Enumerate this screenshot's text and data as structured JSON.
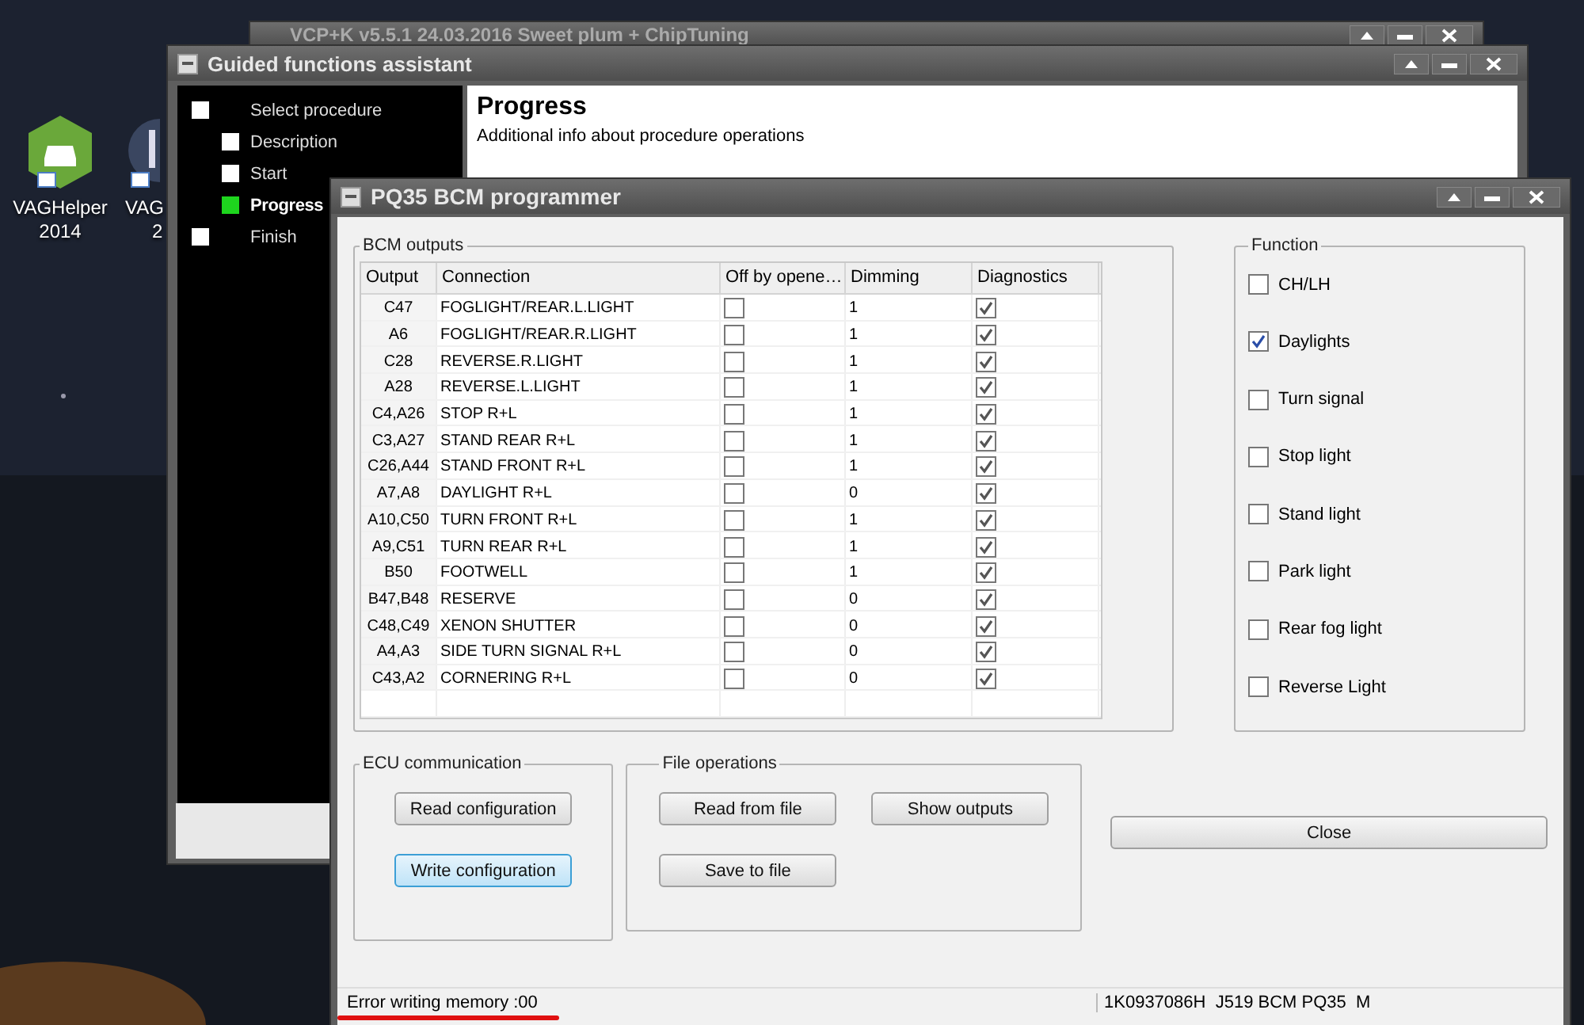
{
  "desktop": {
    "icons": [
      {
        "kind": "car",
        "lines": [
          "VAGHelper",
          "2014"
        ]
      },
      {
        "kind": "round",
        "lines": [
          "VAG",
          "2"
        ]
      }
    ]
  },
  "back_window": {
    "title": "VCP+K v5.5.1 24.03.2016 Sweet plum + ChipTuning"
  },
  "guided_window": {
    "title": "Guided functions assistant",
    "steps": [
      {
        "label": "Select procedure",
        "selected": false
      },
      {
        "label": "Description",
        "selected": false
      },
      {
        "label": "Start",
        "selected": false
      },
      {
        "label": "Progress",
        "selected": true
      },
      {
        "label": "Finish",
        "selected": false
      }
    ],
    "header": {
      "title": "Progress",
      "subtitle": "Additional info about procedure operations"
    }
  },
  "programmer": {
    "title": "PQ35 BCM programmer",
    "bcm_outputs": {
      "legend": "BCM outputs",
      "columns": [
        "Output",
        "Connection",
        "Off by opene…",
        "Dimming",
        "Diagnostics"
      ],
      "rows": [
        {
          "output": "C47",
          "connection": "FOGLIGHT/REAR.L.LIGHT",
          "off_by_opener": false,
          "dimming": "1",
          "diagnostics": true
        },
        {
          "output": "A6",
          "connection": "FOGLIGHT/REAR.R.LIGHT",
          "off_by_opener": false,
          "dimming": "1",
          "diagnostics": true
        },
        {
          "output": "C28",
          "connection": "REVERSE.R.LIGHT",
          "off_by_opener": false,
          "dimming": "1",
          "diagnostics": true
        },
        {
          "output": "A28",
          "connection": "REVERSE.L.LIGHT",
          "off_by_opener": false,
          "dimming": "1",
          "diagnostics": true
        },
        {
          "output": "C4,A26",
          "connection": "STOP R+L",
          "off_by_opener": false,
          "dimming": "1",
          "diagnostics": true
        },
        {
          "output": "C3,A27",
          "connection": "STAND REAR R+L",
          "off_by_opener": false,
          "dimming": "1",
          "diagnostics": true
        },
        {
          "output": "C26,A44",
          "connection": "STAND FRONT R+L",
          "off_by_opener": false,
          "dimming": "1",
          "diagnostics": true
        },
        {
          "output": "A7,A8",
          "connection": "DAYLIGHT R+L",
          "off_by_opener": false,
          "dimming": "0",
          "diagnostics": true
        },
        {
          "output": "A10,C50",
          "connection": "TURN FRONT R+L",
          "off_by_opener": false,
          "dimming": "1",
          "diagnostics": true
        },
        {
          "output": "A9,C51",
          "connection": "TURN REAR R+L",
          "off_by_opener": false,
          "dimming": "1",
          "diagnostics": true
        },
        {
          "output": "B50",
          "connection": "FOOTWELL",
          "off_by_opener": false,
          "dimming": "1",
          "diagnostics": true
        },
        {
          "output": "B47,B48",
          "connection": "RESERVE",
          "off_by_opener": false,
          "dimming": "0",
          "diagnostics": true
        },
        {
          "output": "C48,C49",
          "connection": "XENON SHUTTER",
          "off_by_opener": false,
          "dimming": "0",
          "diagnostics": true
        },
        {
          "output": "A4,A3",
          "connection": "SIDE TURN SIGNAL R+L",
          "off_by_opener": false,
          "dimming": "0",
          "diagnostics": true
        },
        {
          "output": "C43,A2",
          "connection": "CORNERING R+L",
          "off_by_opener": false,
          "dimming": "0",
          "diagnostics": true
        }
      ]
    },
    "function": {
      "legend": "Function",
      "options": [
        {
          "label": "CH/LH",
          "checked": false
        },
        {
          "label": "Daylights",
          "checked": true
        },
        {
          "label": "Turn signal",
          "checked": false
        },
        {
          "label": "Stop light",
          "checked": false
        },
        {
          "label": "Stand light",
          "checked": false
        },
        {
          "label": "Park light",
          "checked": false
        },
        {
          "label": "Rear fog light",
          "checked": false
        },
        {
          "label": "Reverse Light",
          "checked": false
        }
      ]
    },
    "ecu_communication": {
      "legend": "ECU communication",
      "buttons": [
        {
          "label": "Read configuration",
          "focused": false
        },
        {
          "label": "Write configuration",
          "focused": true
        }
      ]
    },
    "file_operations": {
      "legend": "File operations",
      "buttons": [
        {
          "label": "Read from file"
        },
        {
          "label": "Show outputs"
        },
        {
          "label": "Save to file"
        }
      ]
    },
    "close_button": "Close",
    "status_bar": {
      "message": "Error writing memory :00",
      "underlined": true,
      "info": "1K0937086H  J519 BCM PQ35  M"
    }
  }
}
